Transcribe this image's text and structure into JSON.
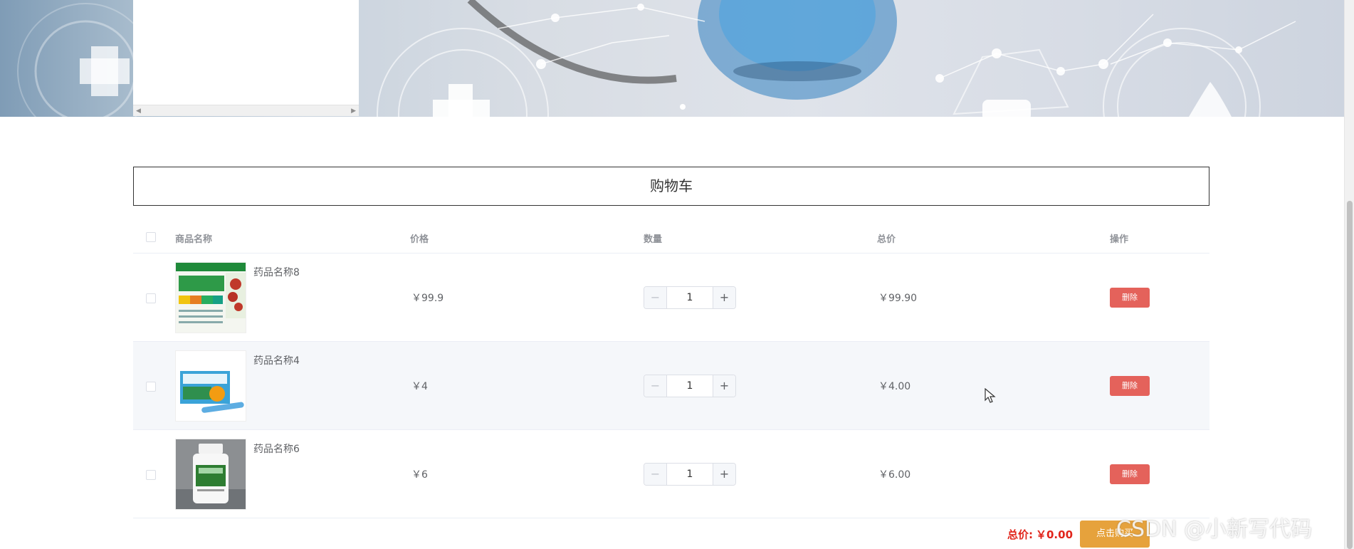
{
  "colors": {
    "danger": "#e4625b",
    "warning": "#e6a23c",
    "price_red": "#e1251b",
    "row_hover": "#f5f7fa"
  },
  "cart": {
    "title": "购物车",
    "columns": {
      "name": "商品名称",
      "price": "价格",
      "quantity": "数量",
      "total": "总价",
      "action": "操作"
    },
    "items": [
      {
        "name": "药品名称8",
        "price": "￥99.9",
        "quantity": "1",
        "subtotal": "￥99.90",
        "delete_label": "删除",
        "image": "健胃消食片 medicine box"
      },
      {
        "name": "药品名称4",
        "price": "￥4",
        "quantity": "1",
        "subtotal": "￥4.00",
        "delete_label": "删除",
        "image": "蒙脱石散 medicine box"
      },
      {
        "name": "药品名称6",
        "price": "￥6",
        "quantity": "1",
        "subtotal": "￥6.00",
        "delete_label": "删除",
        "image": "white medicine bottle"
      }
    ],
    "stepper": {
      "minus": "−",
      "plus": "+"
    },
    "summary": {
      "total_label": "总价:",
      "total_value": "￥0.00",
      "buy_label": "点击购买"
    }
  },
  "watermark": "CSDN @小新写代码",
  "icons": {
    "cursor": "mouse-pointer-icon",
    "scroll_left": "arrow-left-icon",
    "scroll_right": "arrow-right-icon"
  }
}
